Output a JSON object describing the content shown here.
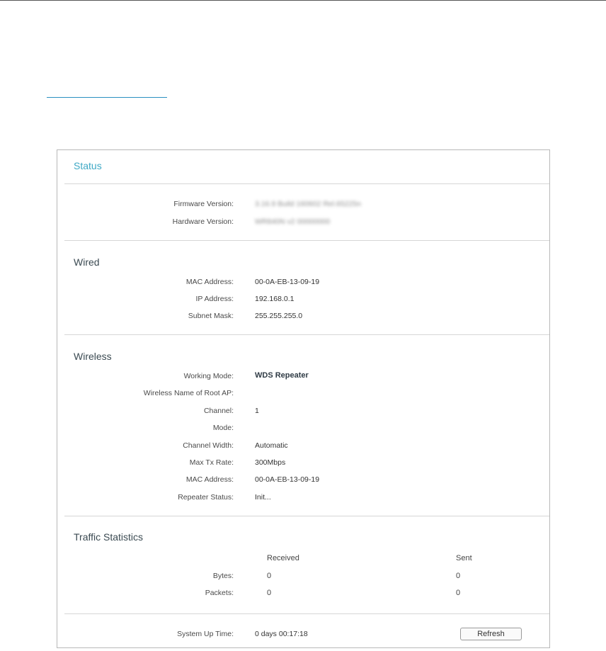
{
  "status": {
    "title": "Status",
    "firmware_label": "Firmware Version:",
    "firmware_value": "3.16.9 Build 160602 Rel.65225n",
    "hardware_label": "Hardware Version:",
    "hardware_value": "WR840N v2 00000000"
  },
  "wired": {
    "title": "Wired",
    "mac_label": "MAC Address:",
    "mac_value": "00-0A-EB-13-09-19",
    "ip_label": "IP Address:",
    "ip_value": "192.168.0.1",
    "subnet_label": "Subnet Mask:",
    "subnet_value": "255.255.255.0"
  },
  "wireless": {
    "title": "Wireless",
    "working_mode_label": "Working Mode:",
    "working_mode_value": "WDS Repeater",
    "root_ap_label": "Wireless Name of Root AP:",
    "root_ap_value": "",
    "channel_label": "Channel:",
    "channel_value": "1",
    "mode_label": "Mode:",
    "mode_value": "",
    "channel_width_label": "Channel Width:",
    "channel_width_value": "Automatic",
    "max_tx_label": "Max Tx Rate:",
    "max_tx_value": "300Mbps",
    "mac_label": "MAC Address:",
    "mac_value": "00-0A-EB-13-09-19",
    "repeater_status_label": "Repeater Status:",
    "repeater_status_value": "Init..."
  },
  "traffic": {
    "title": "Traffic Statistics",
    "received_header": "Received",
    "sent_header": "Sent",
    "bytes_label": "Bytes:",
    "bytes_received": "0",
    "bytes_sent": "0",
    "packets_label": "Packets:",
    "packets_received": "0",
    "packets_sent": "0"
  },
  "system": {
    "uptime_label": "System Up Time:",
    "uptime_value": "0 days 00:17:18",
    "refresh_label": "Refresh"
  }
}
